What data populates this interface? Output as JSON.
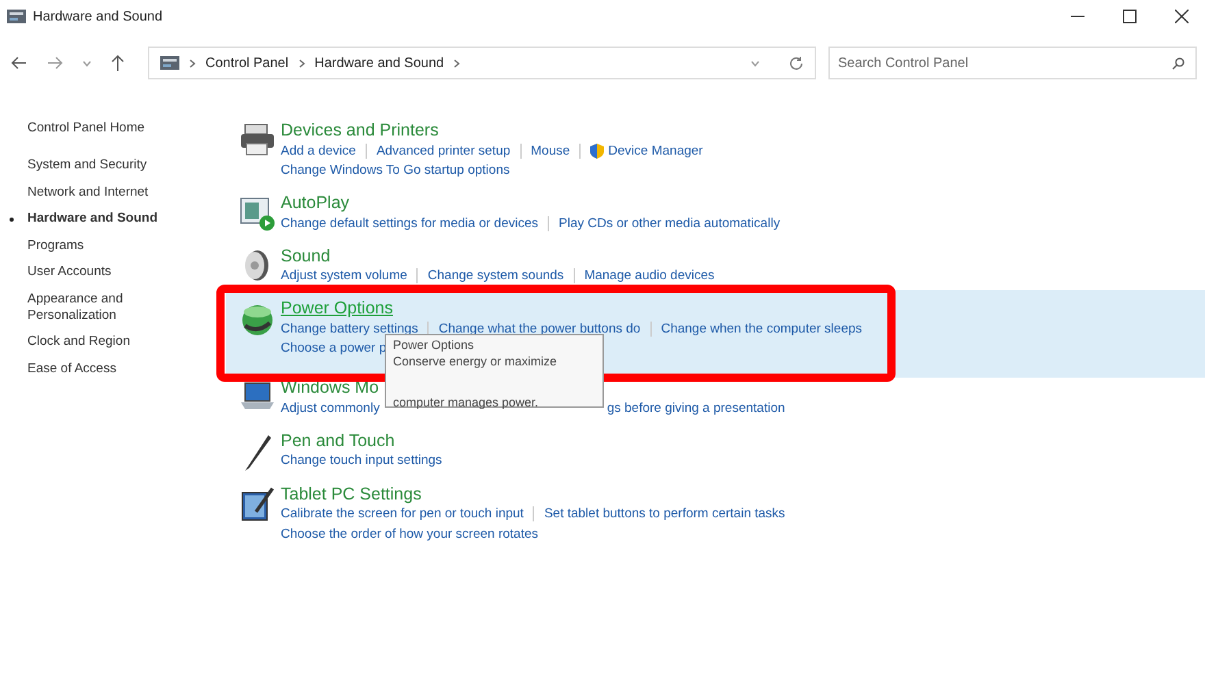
{
  "window": {
    "title": "Hardware and Sound"
  },
  "address": {
    "crumbs": [
      "Control Panel",
      "Hardware and Sound"
    ]
  },
  "search": {
    "placeholder": "Search Control Panel"
  },
  "sidebar": {
    "items": [
      {
        "label": "Control Panel Home",
        "selected": false
      },
      {
        "label": "System and Security",
        "selected": false
      },
      {
        "label": "Network and Internet",
        "selected": false
      },
      {
        "label": "Hardware and Sound",
        "selected": true
      },
      {
        "label": "Programs",
        "selected": false
      },
      {
        "label": "User Accounts",
        "selected": false
      },
      {
        "label": "Appearance and Personalization",
        "selected": false
      },
      {
        "label": "Clock and Region",
        "selected": false
      },
      {
        "label": "Ease of Access",
        "selected": false
      }
    ]
  },
  "categories": [
    {
      "title": "Devices and Printers",
      "selected": false,
      "links": [
        [
          "Add a device",
          "Advanced printer setup",
          "Mouse",
          "Device Manager"
        ],
        [
          "Change Windows To Go startup options"
        ]
      ]
    },
    {
      "title": "AutoPlay",
      "selected": false,
      "links": [
        [
          "Change default settings for media or devices",
          "Play CDs or other media automatically"
        ]
      ]
    },
    {
      "title": "Sound",
      "selected": false,
      "links": [
        [
          "Adjust system volume",
          "Change system sounds",
          "Manage audio devices"
        ]
      ]
    },
    {
      "title": "Power Options",
      "selected": true,
      "links": [
        [
          "Change battery settings",
          "Change what the power buttons do",
          "Change when the computer sleeps"
        ],
        [
          "Choose a power p"
        ]
      ]
    },
    {
      "title": "Windows Mo",
      "selected": false,
      "links": [
        [
          "Adjust commonly",
          "gs before giving a presentation"
        ]
      ]
    },
    {
      "title": "Pen and Touch",
      "selected": false,
      "links": [
        [
          "Change touch input settings"
        ]
      ]
    },
    {
      "title": "Tablet PC Settings",
      "selected": false,
      "links": [
        [
          "Calibrate the screen for pen or touch input",
          "Set tablet buttons to perform certain tasks"
        ],
        [
          "Choose the order of how your screen rotates"
        ]
      ]
    }
  ],
  "tooltip": {
    "lines": [
      "Power Options",
      "Conserve energy or maximize",
      "computer manages power."
    ]
  }
}
